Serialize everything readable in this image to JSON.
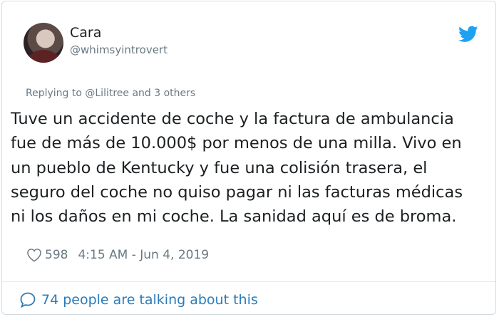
{
  "tweet": {
    "author_name": "Cara",
    "author_handle": "@whimsyintrovert",
    "replying_to": "Replying to @Lilitree and 3 others",
    "text": "Tuve un accidente de coche y la factura de ambulancia\nfue de más de 10.000$ por menos de una milla. Vivo en\nun pueblo de Kentucky y fue una colisión trasera, el\nseguro del coche no quiso pagar ni las facturas médicas\nni los daños en mi coche. La sanidad aquí es de broma.",
    "like_count": "598",
    "timestamp": "4:15 AM - Jun 4, 2019",
    "talking_text": "74 people are talking about this"
  },
  "colors": {
    "twitter_blue": "#1da1f2",
    "link_blue": "#2b7bb9",
    "muted_gray": "#697882",
    "text_dark": "#1c2022"
  },
  "icons": {
    "logo": "twitter-bird-icon",
    "like": "heart-icon",
    "conversation": "speech-bubble-icon"
  }
}
